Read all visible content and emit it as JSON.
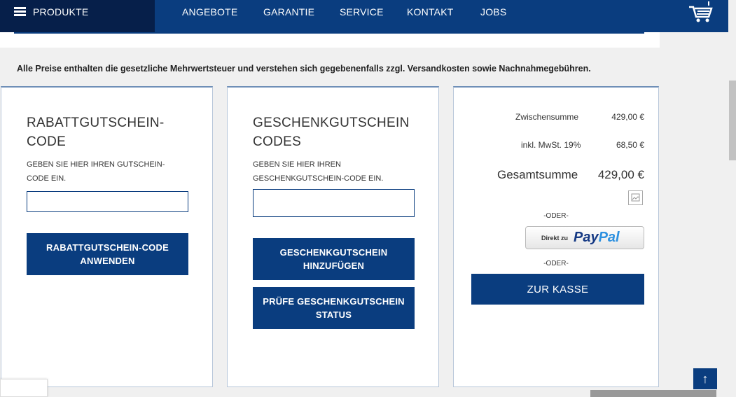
{
  "nav": {
    "produkte": "PRODUKTE",
    "items": [
      "ANGEBOTE",
      "GARANTIE",
      "SERVICE",
      "KONTAKT",
      "JOBS"
    ],
    "cart_icon": "shopping-cart-icon"
  },
  "notice": "Alle Preise enthalten die gesetzliche Mehrwertsteuer und verstehen sich gegebenenfalls zzgl. Versandkosten sowie Nachnahmegebühren.",
  "rabatt": {
    "title_line1": "RABATTGUTSCHEIN-",
    "title_line2": "CODE",
    "sub_line1": "GEBEN SIE HIER IHREN GUTSCHEIN-",
    "sub_line2": "CODE EIN.",
    "input_value": "",
    "button_line1": "RABATTGUTSCHEIN-CODE",
    "button_line2": "ANWENDEN"
  },
  "geschenk": {
    "title_line1": "GESCHENKGUTSCHEIN",
    "title_line2": "CODES",
    "sub_line1": "GEBEN SIE HIER IHREN",
    "sub_line2": "GESCHENKGUTSCHEIN-CODE EIN.",
    "input_value": "",
    "add_line1": "GESCHENKGUTSCHEIN",
    "add_line2": "HINZUFÜGEN",
    "check_line1": "PRÜFE GESCHENKGUTSCHEIN",
    "check_line2": "STATUS"
  },
  "totals": {
    "zwischensumme_label": "Zwischensumme",
    "zwischensumme_value": "429,00 €",
    "mwst_label": "inkl. MwSt. 19%",
    "mwst_value": "68,50 €",
    "gesamt_label": "Gesamtsumme",
    "gesamt_value": "429,00 €",
    "oder": "-ODER-",
    "paypal_prefix": "Direkt zu",
    "paypal_pay": "Pay",
    "paypal_pal": "Pal",
    "checkout": "ZUR KASSE"
  },
  "totop": "↑",
  "colors": {
    "primary": "#0a3d7f",
    "dark": "#061f4a"
  }
}
